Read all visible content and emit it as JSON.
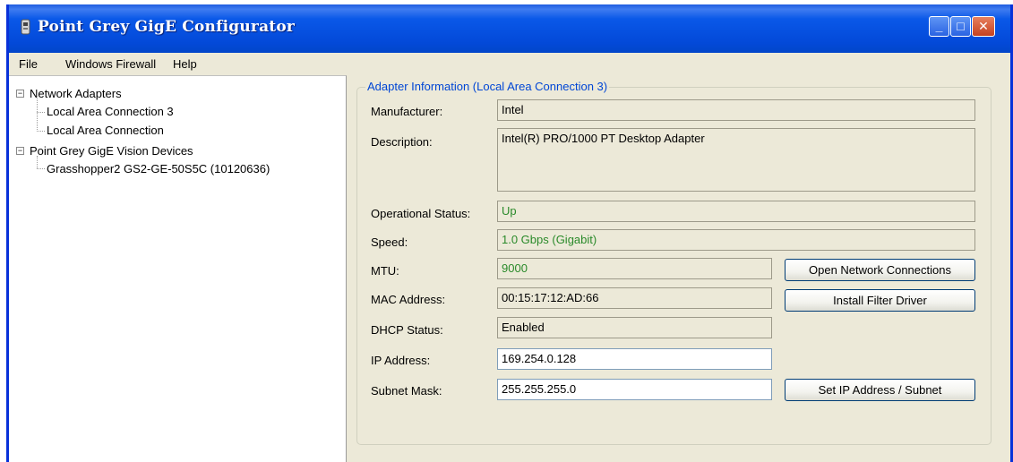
{
  "window": {
    "title": "Point Grey GigE Configurator",
    "controls": {
      "minimize": "_",
      "maximize": "□",
      "close": "✕"
    }
  },
  "menu": [
    "File",
    "Windows Firewall",
    "Help"
  ],
  "tree": {
    "groups": [
      {
        "label": "Network Adapters",
        "expander": "−",
        "children": [
          "Local Area Connection 3",
          "Local Area Connection"
        ]
      },
      {
        "label": "Point Grey GigE Vision Devices",
        "expander": "−",
        "children": [
          "Grasshopper2 GS2-GE-50S5C (10120636)"
        ]
      }
    ]
  },
  "adapter": {
    "group_title": "Adapter Information (Local Area Connection 3)",
    "fields": {
      "manufacturer": {
        "label": "Manufacturer:",
        "value": "Intel"
      },
      "description": {
        "label": "Description:",
        "value": "Intel(R) PRO/1000 PT Desktop Adapter"
      },
      "status": {
        "label": "Operational Status:",
        "value": "Up"
      },
      "speed": {
        "label": "Speed:",
        "value": "1.0 Gbps (Gigabit)"
      },
      "mtu": {
        "label": "MTU:",
        "value": "9000"
      },
      "mac": {
        "label": "MAC Address:",
        "value": "00:15:17:12:AD:66"
      },
      "dhcp": {
        "label": "DHCP Status:",
        "value": "Enabled"
      },
      "ip": {
        "label": "IP Address:",
        "value": "169.254.0.128"
      },
      "subnet": {
        "label": "Subnet Mask:",
        "value": "255.255.255.0"
      }
    },
    "buttons": {
      "open_connections": "Open Network Connections",
      "install_driver": "Install Filter Driver",
      "set_ip": "Set IP Address /  Subnet"
    }
  },
  "colors": {
    "titlebar": "#0349d8",
    "window_bg": "#ECE9D8",
    "group_title": "#0046d5",
    "good_value": "#2a8a2a"
  }
}
